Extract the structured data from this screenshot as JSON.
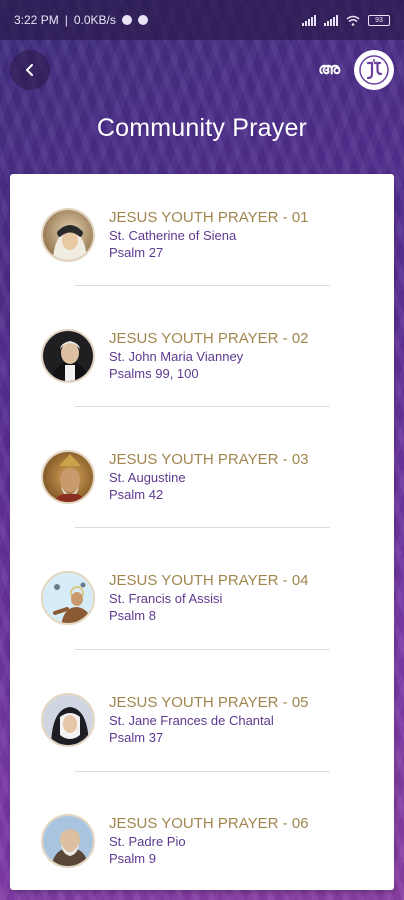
{
  "status_bar": {
    "time": "3:22 PM",
    "speed": "0.0KB/s",
    "battery": "93"
  },
  "header": {
    "lang_label": "അ",
    "title": "Community Prayer"
  },
  "prayers": [
    {
      "title": "JESUS YOUTH PRAYER - 01",
      "saint": "St. Catherine of Siena",
      "psalm": "Psalm 27"
    },
    {
      "title": "JESUS YOUTH PRAYER - 02",
      "saint": "St. John Maria Vianney",
      "psalm": "Psalms 99, 100"
    },
    {
      "title": "JESUS YOUTH PRAYER - 03",
      "saint": "St. Augustine",
      "psalm": "Psalm 42"
    },
    {
      "title": "JESUS YOUTH PRAYER - 04",
      "saint": "St. Francis of Assisi",
      "psalm": "Psalm 8"
    },
    {
      "title": "JESUS YOUTH PRAYER - 05",
      "saint": "St. Jane Frances de Chantal",
      "psalm": "Psalm 37"
    },
    {
      "title": "JESUS YOUTH PRAYER - 06",
      "saint": "St. Padre Pio",
      "psalm": "Psalm 9"
    }
  ],
  "colors": {
    "title_gold": "#a0864e",
    "subtitle_purple": "#5d3a8f",
    "background_top": "#3d2d7d",
    "background_bottom": "#8a3fa5"
  }
}
